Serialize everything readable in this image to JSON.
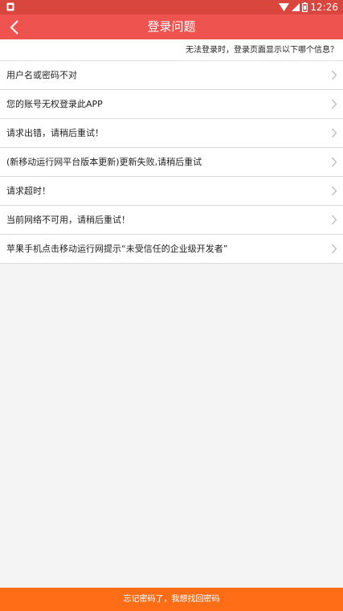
{
  "status_bar": {
    "time": "12:26",
    "left_icon": "notification-icon",
    "icons": [
      "wifi-icon",
      "signal-icon",
      "battery-icon"
    ]
  },
  "header": {
    "title": "登录问题",
    "back_icon": "chevron-left-icon"
  },
  "subheader": {
    "text": "无法登录时，登录页面显示以下哪个信息？"
  },
  "problems": [
    {
      "label": "用户名或密码不对"
    },
    {
      "label": "您的账号无权登录此APP"
    },
    {
      "label": "请求出错，请稍后重试！"
    },
    {
      "label": "(新移动运行网平台版本更新)更新失败,请稍后重试"
    },
    {
      "label": "请求超时！"
    },
    {
      "label": "当前网络不可用，请稍后重试！"
    },
    {
      "label": "苹果手机点击移动运行网提示“未受信任的企业级开发者”"
    }
  ],
  "footer": {
    "forgot_password_label": "忘记密码了，我想找回密码"
  },
  "colors": {
    "status_bar": "#d9463e",
    "title_bar": "#ef5350",
    "footer": "#ff6d17",
    "background": "#f4f4f4"
  }
}
